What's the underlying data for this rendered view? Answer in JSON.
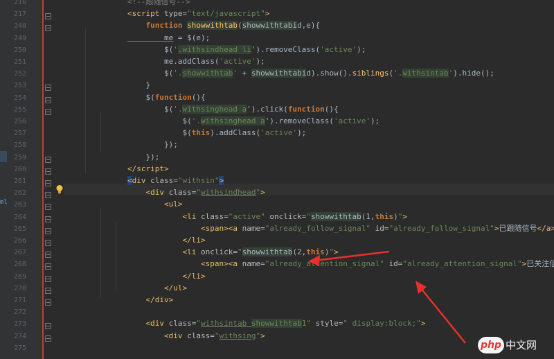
{
  "gutter": {
    "line_numbers": [
      "216",
      "217",
      "248",
      "249",
      "250",
      "251",
      "252",
      "253",
      "254",
      "255",
      "256",
      "257",
      "258",
      "259",
      "260",
      "261",
      "262",
      "263",
      "264",
      "265",
      "266",
      "267",
      "268",
      "269",
      "270",
      "271",
      "272",
      "273",
      "274",
      "275"
    ],
    "side_label": "ml"
  },
  "code": {
    "lines": [
      [
        {
          "t": "<!--跟随信号-->",
          "c": "t-com"
        }
      ],
      [
        {
          "t": "<",
          "c": "t-tag"
        },
        {
          "t": "script ",
          "c": "t-tag"
        },
        {
          "t": "type=",
          "c": "t-attr"
        },
        {
          "t": "\"text/javascript\"",
          "c": "t-str"
        },
        {
          "t": ">",
          "c": "t-tag"
        }
      ],
      [
        {
          "t": "    function ",
          "c": "t-kw"
        },
        {
          "t": "showwithtab",
          "c": "t-fn hl"
        },
        {
          "t": "(",
          "c": "t-plain"
        },
        {
          "t": "showwithtabi",
          "c": "t-plain hl"
        },
        {
          "t": "d,e){",
          "c": "t-plain"
        }
      ],
      [
        {
          "t": "        me",
          "c": "t-plain under"
        },
        {
          "t": " = $(e);",
          "c": "t-plain"
        }
      ],
      [
        {
          "t": "        $(",
          "c": "t-plain"
        },
        {
          "t": "'",
          "c": "t-str"
        },
        {
          "t": ".withsindhead li",
          "c": "t-str hl"
        },
        {
          "t": "').removeClass(",
          "c": "t-plain"
        },
        {
          "t": "'active'",
          "c": "t-str"
        },
        {
          "t": ");",
          "c": "t-plain"
        }
      ],
      [
        {
          "t": "        me.addClass(",
          "c": "t-plain"
        },
        {
          "t": "'active'",
          "c": "t-str"
        },
        {
          "t": ");",
          "c": "t-plain"
        }
      ],
      [
        {
          "t": "        $(",
          "c": "t-plain"
        },
        {
          "t": "'.",
          "c": "t-str"
        },
        {
          "t": "showwithtab",
          "c": "t-str hl"
        },
        {
          "t": "'",
          "c": "t-str"
        },
        {
          "t": " + ",
          "c": "t-plain"
        },
        {
          "t": "showwithtabi",
          "c": "t-plain hl"
        },
        {
          "t": "d).show().",
          "c": "t-plain"
        },
        {
          "t": "siblings",
          "c": "t-fn"
        },
        {
          "t": "(",
          "c": "t-plain"
        },
        {
          "t": "'.",
          "c": "t-str"
        },
        {
          "t": "withsintab",
          "c": "t-str hl"
        },
        {
          "t": "'",
          "c": "t-str"
        },
        {
          "t": ").hide();",
          "c": "t-plain"
        }
      ],
      [
        {
          "t": "    }",
          "c": "t-plain"
        }
      ],
      [
        {
          "t": "    $(",
          "c": "t-plain"
        },
        {
          "t": "function",
          "c": "t-kw"
        },
        {
          "t": "(){",
          "c": "t-plain"
        }
      ],
      [
        {
          "t": "        $(",
          "c": "t-plain"
        },
        {
          "t": "'.",
          "c": "t-str"
        },
        {
          "t": "withsinghead a",
          "c": "t-str hl"
        },
        {
          "t": "').click(",
          "c": "t-plain"
        },
        {
          "t": "function",
          "c": "t-kw"
        },
        {
          "t": "(){",
          "c": "t-plain"
        }
      ],
      [
        {
          "t": "            $(",
          "c": "t-plain"
        },
        {
          "t": "'.",
          "c": "t-str"
        },
        {
          "t": "withsinghead a",
          "c": "t-str hl"
        },
        {
          "t": "').removeClass(",
          "c": "t-plain"
        },
        {
          "t": "'active'",
          "c": "t-str"
        },
        {
          "t": ");",
          "c": "t-plain"
        }
      ],
      [
        {
          "t": "            $(",
          "c": "t-plain"
        },
        {
          "t": "this",
          "c": "t-kw"
        },
        {
          "t": ").addClass(",
          "c": "t-plain"
        },
        {
          "t": "'active'",
          "c": "t-str"
        },
        {
          "t": ");",
          "c": "t-plain"
        }
      ],
      [
        {
          "t": "        });",
          "c": "t-plain"
        }
      ],
      [
        {
          "t": "    });",
          "c": "t-plain"
        }
      ],
      [
        {
          "t": "</",
          "c": "t-tag"
        },
        {
          "t": "script",
          "c": "t-tag"
        },
        {
          "t": ">",
          "c": "t-tag"
        }
      ],
      [
        {
          "t": "<",
          "c": "t-tag hl-b"
        },
        {
          "t": "div ",
          "c": "t-tag"
        },
        {
          "t": "class=",
          "c": "t-attr"
        },
        {
          "t": "\"withsin\"",
          "c": "t-str"
        },
        {
          "t": ">",
          "c": "t-tag hl-b"
        }
      ],
      [
        {
          "t": "    <",
          "c": "t-tag"
        },
        {
          "t": "div ",
          "c": "t-tag"
        },
        {
          "t": "class=",
          "c": "t-attr"
        },
        {
          "t": "\"",
          "c": "t-str"
        },
        {
          "t": "withsindhead",
          "c": "t-str under"
        },
        {
          "t": "\"",
          "c": "t-str"
        },
        {
          "t": ">",
          "c": "t-tag"
        }
      ],
      [
        {
          "t": "        <",
          "c": "t-tag"
        },
        {
          "t": "ul",
          "c": "t-tag"
        },
        {
          "t": ">",
          "c": "t-tag"
        }
      ],
      [
        {
          "t": "            <",
          "c": "t-tag"
        },
        {
          "t": "li ",
          "c": "t-tag"
        },
        {
          "t": "class=",
          "c": "t-attr"
        },
        {
          "t": "\"active\"",
          "c": "t-str"
        },
        {
          "t": " onclick=",
          "c": "t-attr"
        },
        {
          "t": "\"",
          "c": "t-str"
        },
        {
          "t": "showwithtab",
          "c": "t-plain hl"
        },
        {
          "t": "(1,",
          "c": "t-plain"
        },
        {
          "t": "this",
          "c": "t-kw"
        },
        {
          "t": ")",
          "c": "t-plain"
        },
        {
          "t": "\"",
          "c": "t-str"
        },
        {
          "t": ">",
          "c": "t-tag"
        }
      ],
      [
        {
          "t": "                <",
          "c": "t-tag"
        },
        {
          "t": "span",
          "c": "t-tag"
        },
        {
          "t": "><",
          "c": "t-tag"
        },
        {
          "t": "a ",
          "c": "t-tag"
        },
        {
          "t": "name=",
          "c": "t-attr"
        },
        {
          "t": "\"already_follow_signal\"",
          "c": "t-str"
        },
        {
          "t": " id=",
          "c": "t-attr"
        },
        {
          "t": "\"already_follow_signal\"",
          "c": "t-str"
        },
        {
          "t": ">",
          "c": "t-tag"
        },
        {
          "t": "已跟随信号",
          "c": "t-txt"
        },
        {
          "t": "</",
          "c": "t-tag"
        },
        {
          "t": "a",
          "c": "t-tag"
        },
        {
          "t": "></",
          "c": "t-tag"
        },
        {
          "t": "span",
          "c": "t-tag"
        },
        {
          "t": ">",
          "c": "t-tag"
        }
      ],
      [
        {
          "t": "            </",
          "c": "t-tag"
        },
        {
          "t": "li",
          "c": "t-tag"
        },
        {
          "t": ">",
          "c": "t-tag"
        }
      ],
      [
        {
          "t": "            <",
          "c": "t-tag"
        },
        {
          "t": "li ",
          "c": "t-tag"
        },
        {
          "t": "onclick=",
          "c": "t-attr"
        },
        {
          "t": "\"",
          "c": "t-str"
        },
        {
          "t": "showwithtab",
          "c": "t-plain hl"
        },
        {
          "t": "(2,",
          "c": "t-plain"
        },
        {
          "t": "this",
          "c": "t-kw"
        },
        {
          "t": ")",
          "c": "t-plain"
        },
        {
          "t": "\"",
          "c": "t-str"
        },
        {
          "t": ">",
          "c": "t-tag"
        }
      ],
      [
        {
          "t": "                <",
          "c": "t-tag"
        },
        {
          "t": "span",
          "c": "t-tag"
        },
        {
          "t": "><",
          "c": "t-tag"
        },
        {
          "t": "a ",
          "c": "t-tag"
        },
        {
          "t": "name=",
          "c": "t-attr"
        },
        {
          "t": "\"already_attention_signal\"",
          "c": "t-str"
        },
        {
          "t": " id=",
          "c": "t-attr"
        },
        {
          "t": "\"already_attention_signal\"",
          "c": "t-str"
        },
        {
          "t": ">",
          "c": "t-tag"
        },
        {
          "t": "已关注信号",
          "c": "t-txt"
        },
        {
          "t": "</",
          "c": "t-tag"
        },
        {
          "t": "a",
          "c": "t-tag"
        },
        {
          "t": "></",
          "c": "t-tag"
        },
        {
          "t": "span",
          "c": "t-tag"
        },
        {
          "t": ">",
          "c": "t-tag"
        }
      ],
      [
        {
          "t": "            </",
          "c": "t-tag"
        },
        {
          "t": "li",
          "c": "t-tag"
        },
        {
          "t": ">",
          "c": "t-tag"
        }
      ],
      [
        {
          "t": "        </",
          "c": "t-tag"
        },
        {
          "t": "ul",
          "c": "t-tag"
        },
        {
          "t": ">",
          "c": "t-tag"
        }
      ],
      [
        {
          "t": "    </",
          "c": "t-tag"
        },
        {
          "t": "div",
          "c": "t-tag"
        },
        {
          "t": ">",
          "c": "t-tag"
        }
      ],
      [],
      [
        {
          "t": "    <",
          "c": "t-tag"
        },
        {
          "t": "div ",
          "c": "t-tag"
        },
        {
          "t": "class=",
          "c": "t-attr"
        },
        {
          "t": "\"",
          "c": "t-str"
        },
        {
          "t": "withsintab ",
          "c": "t-str under"
        },
        {
          "t": "showwithtab",
          "c": "t-str hl"
        },
        {
          "t": "1\"",
          "c": "t-str"
        },
        {
          "t": " style=",
          "c": "t-attr"
        },
        {
          "t": "\" display:block;\"",
          "c": "t-str"
        },
        {
          "t": ">",
          "c": "t-tag"
        }
      ],
      [
        {
          "t": "        <",
          "c": "t-tag"
        },
        {
          "t": "div ",
          "c": "t-tag"
        },
        {
          "t": "class=",
          "c": "t-attr"
        },
        {
          "t": "\"",
          "c": "t-str"
        },
        {
          "t": "withsing",
          "c": "t-str under"
        },
        {
          "t": "\"",
          "c": "t-str"
        },
        {
          "t": ">",
          "c": "t-tag"
        }
      ],
      []
    ]
  },
  "watermark": {
    "badge": "php",
    "site": "中文网"
  },
  "colors": {
    "background": "#2b2b2b",
    "annotation_arrow": "#e8302a"
  },
  "icons": {
    "intention": "lightbulb-icon"
  }
}
